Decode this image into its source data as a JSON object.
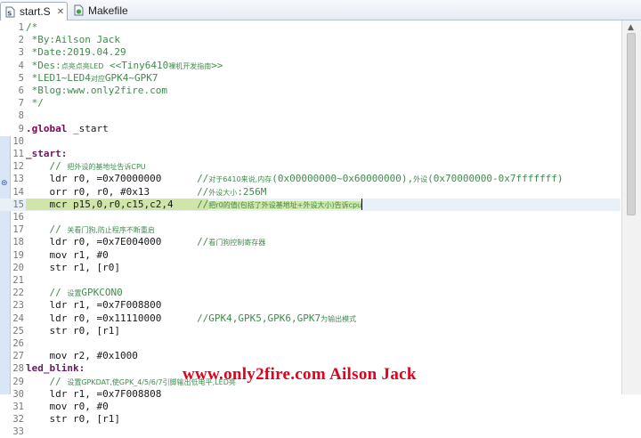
{
  "tabs": [
    {
      "label": "start.S",
      "active": true,
      "icon": "assembly-file-icon",
      "close": "✕"
    },
    {
      "label": "Makefile",
      "active": false,
      "icon": "makefile-icon"
    }
  ],
  "editor": {
    "lines": [
      {
        "n": "1",
        "segs": [
          {
            "c": "cm",
            "t": "/*"
          }
        ]
      },
      {
        "n": "2",
        "segs": [
          {
            "c": "cm",
            "t": " *By:Ailson Jack"
          }
        ]
      },
      {
        "n": "3",
        "segs": [
          {
            "c": "cm",
            "t": " *Date:2019.04.29"
          }
        ]
      },
      {
        "n": "4",
        "segs": [
          {
            "c": "cm",
            "t": " *Des:"
          },
          {
            "c": "zh",
            "t": "点亮点亮LED"
          },
          {
            "c": "cm",
            "t": " <<Tiny6410"
          },
          {
            "c": "zh",
            "t": "裸机开发指南"
          },
          {
            "c": "cm",
            "t": ">>"
          }
        ]
      },
      {
        "n": "5",
        "segs": [
          {
            "c": "cm",
            "t": " *LED1~LED4"
          },
          {
            "c": "zh",
            "t": "对应"
          },
          {
            "c": "cm",
            "t": "GPK4~GPK7"
          }
        ]
      },
      {
        "n": "6",
        "segs": [
          {
            "c": "cm",
            "t": " *Blog:www.only2fire.com"
          }
        ]
      },
      {
        "n": "7",
        "segs": [
          {
            "c": "cm",
            "t": " */"
          }
        ]
      },
      {
        "n": "8",
        "segs": []
      },
      {
        "n": "9",
        "segs": [
          {
            "c": "kw",
            "t": ".global"
          },
          {
            "c": "ins",
            "t": " _start"
          }
        ]
      },
      {
        "n": "10",
        "segs": []
      },
      {
        "n": "11",
        "segs": [
          {
            "c": "lbl",
            "t": "_start:"
          }
        ]
      },
      {
        "n": "12",
        "segs": [
          {
            "c": "cm",
            "t": "    // "
          },
          {
            "c": "zh",
            "t": "把外设的基地址告诉CPU"
          }
        ]
      },
      {
        "n": "13",
        "segs": [
          {
            "c": "ins",
            "t": "    ldr r0, =0x70000000      "
          },
          {
            "c": "cm",
            "t": "//"
          },
          {
            "c": "zh",
            "t": "对于6410来说,内存"
          },
          {
            "c": "cm",
            "t": "(0x00000000~0x60000000),"
          },
          {
            "c": "zh",
            "t": "外设"
          },
          {
            "c": "cm",
            "t": "(0x70000000-0x7fffffff)"
          }
        ]
      },
      {
        "n": "14",
        "segs": [
          {
            "c": "ins",
            "t": "    orr r0, r0, #0x13        "
          },
          {
            "c": "cm",
            "t": "//"
          },
          {
            "c": "zh",
            "t": "外设大小"
          },
          {
            "c": "cm",
            "t": ":256M"
          }
        ]
      },
      {
        "n": "15",
        "current": true,
        "segs": [
          {
            "c": "ins sel",
            "t": "    mcr p15,0,r0,c15,c2,4    "
          },
          {
            "c": "cm sel",
            "t": "//"
          },
          {
            "c": "zh sel",
            "t": "把r0的值(包括了外设基地址+外设大小)告诉cpu"
          }
        ]
      },
      {
        "n": "16",
        "segs": []
      },
      {
        "n": "17",
        "segs": [
          {
            "c": "cm",
            "t": "    // "
          },
          {
            "c": "zh",
            "t": "关看门狗,防止程序不断重启"
          }
        ]
      },
      {
        "n": "18",
        "segs": [
          {
            "c": "ins",
            "t": "    ldr r0, =0x7E004000      "
          },
          {
            "c": "cm",
            "t": "//"
          },
          {
            "c": "zh",
            "t": "看门狗控制寄存器"
          }
        ]
      },
      {
        "n": "19",
        "segs": [
          {
            "c": "ins",
            "t": "    mov r1, #0"
          }
        ]
      },
      {
        "n": "20",
        "segs": [
          {
            "c": "ins",
            "t": "    str r1, [r0]"
          }
        ]
      },
      {
        "n": "21",
        "segs": []
      },
      {
        "n": "22",
        "segs": [
          {
            "c": "cm",
            "t": "    // "
          },
          {
            "c": "zh",
            "t": "设置"
          },
          {
            "c": "cm",
            "t": "GPKCON0"
          }
        ]
      },
      {
        "n": "23",
        "segs": [
          {
            "c": "ins",
            "t": "    ldr r1, =0x7F008800"
          }
        ]
      },
      {
        "n": "24",
        "segs": [
          {
            "c": "ins",
            "t": "    ldr r0, =0x11110000      "
          },
          {
            "c": "cm",
            "t": "//GPK4,GPK5,GPK6,GPK7"
          },
          {
            "c": "zh",
            "t": "为输出模式"
          }
        ]
      },
      {
        "n": "25",
        "segs": [
          {
            "c": "ins",
            "t": "    str r0, [r1]"
          }
        ]
      },
      {
        "n": "26",
        "segs": []
      },
      {
        "n": "27",
        "segs": [
          {
            "c": "ins",
            "t": "    mov r2, #0x1000"
          }
        ]
      },
      {
        "n": "28",
        "segs": [
          {
            "c": "lbl",
            "t": "led_blink:"
          }
        ]
      },
      {
        "n": "29",
        "segs": [
          {
            "c": "cm",
            "t": "    // "
          },
          {
            "c": "zh",
            "t": "设置GPKDAT,使GPK_4/5/6/7引脚输出低电平,LED亮"
          }
        ]
      },
      {
        "n": "30",
        "segs": [
          {
            "c": "ins",
            "t": "    ldr r1, =0x7F008808"
          }
        ]
      },
      {
        "n": "31",
        "segs": [
          {
            "c": "ins",
            "t": "    mov r0, #0"
          }
        ]
      },
      {
        "n": "32",
        "segs": [
          {
            "c": "ins",
            "t": "    str r0, [r1]"
          }
        ]
      },
      {
        "n": "33",
        "segs": []
      }
    ]
  },
  "watermark": "www.only2fire.com Ailson Jack",
  "colors": {
    "comment": "#3f8c4c",
    "keyword": "#7f0055",
    "selection": "#cfe6a8",
    "current_line": "#e8f1f7",
    "watermark": "#e1001e"
  }
}
